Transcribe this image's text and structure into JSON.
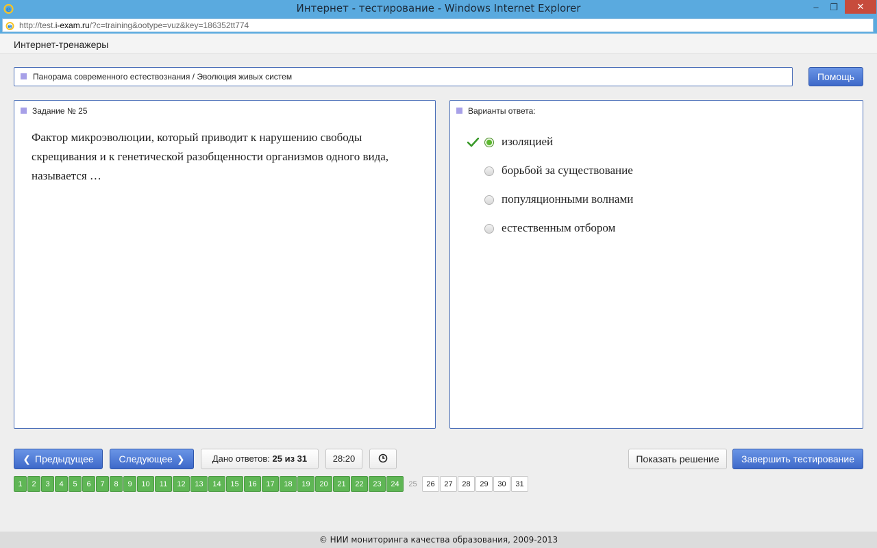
{
  "window": {
    "title": "Интернет - тестирование - Windows Internet Explorer",
    "minimize": "–",
    "maximize": "❐",
    "close": "✕"
  },
  "address": {
    "url_prefix": "http://test.",
    "url_domain": "i-exam.ru",
    "url_rest": "/?c=training&ootype=vuz&key=186352tt774"
  },
  "header": {
    "brand": "Интернет-тренажеры"
  },
  "breadcrumb": {
    "text": "Панорама современного естествознания / Эволюция живых систем"
  },
  "help_label": "Помощь",
  "task": {
    "title": "Задание № 25",
    "question": "Фактор микроэволюции, который приводит к нарушению свободы скрещивания и к генетической разобщенности организмов одного вида, называется …"
  },
  "answers": {
    "title": "Варианты ответа:",
    "options": [
      {
        "label": "изоляцией",
        "selected": true
      },
      {
        "label": "борьбой за существование",
        "selected": false
      },
      {
        "label": "популяционными волнами",
        "selected": false
      },
      {
        "label": "естественным отбором",
        "selected": false
      }
    ]
  },
  "nav": {
    "prev_label": "Предыдущее",
    "next_label": "Следующее",
    "answered_prefix": "Дано ответов:",
    "answered_value": "25 из 31",
    "timer": "28:20",
    "show_solution": "Показать решение",
    "finish": "Завершить тестирование"
  },
  "pages": {
    "total": 31,
    "current": 25,
    "done_through": 24,
    "labels": [
      "1",
      "2",
      "3",
      "4",
      "5",
      "6",
      "7",
      "8",
      "9",
      "10",
      "11",
      "12",
      "13",
      "14",
      "15",
      "16",
      "17",
      "18",
      "19",
      "20",
      "21",
      "22",
      "23",
      "24",
      "25",
      "26",
      "27",
      "28",
      "29",
      "30",
      "31"
    ]
  },
  "footer": "© НИИ мониторинга качества образования, 2009-2013",
  "colors": {
    "accent_blue": "#4b6fb8",
    "done_green": "#5fb655",
    "titlebar": "#5aaadf"
  }
}
